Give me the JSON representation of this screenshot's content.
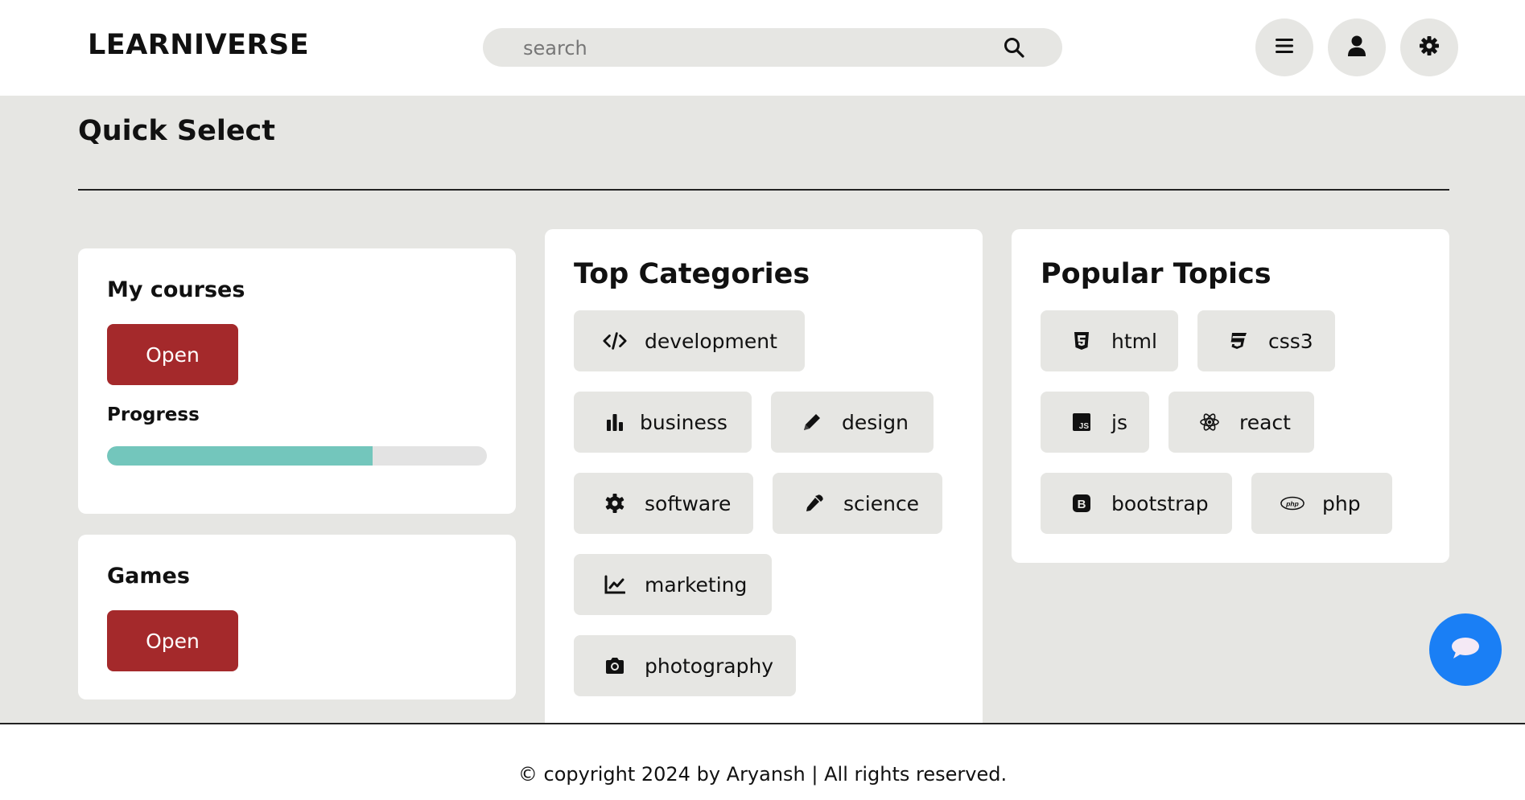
{
  "header": {
    "logo": "LEARNIVERSE",
    "search_placeholder": "search",
    "buttons": [
      "menu-icon",
      "user-icon",
      "gear-icon"
    ]
  },
  "main": {
    "title": "Quick Select",
    "my_courses": {
      "title": "My courses",
      "open_label": "Open",
      "progress_label": "Progress",
      "progress_fraction": 0.7
    },
    "games": {
      "title": "Games",
      "open_label": "Open"
    },
    "top_categories": {
      "title": "Top Categories",
      "items": [
        {
          "label": "development",
          "icon": "code-icon"
        },
        {
          "label": "business",
          "icon": "bar-chart-icon"
        },
        {
          "label": "design",
          "icon": "pencil-icon"
        },
        {
          "label": "software",
          "icon": "gear-icon"
        },
        {
          "label": "science",
          "icon": "pipette-icon"
        },
        {
          "label": "marketing",
          "icon": "line-chart-icon"
        },
        {
          "label": "photography",
          "icon": "camera-icon"
        }
      ]
    },
    "popular_topics": {
      "title": "Popular Topics",
      "items": [
        {
          "label": "html",
          "icon": "html5-icon"
        },
        {
          "label": "css3",
          "icon": "css3-icon"
        },
        {
          "label": "js",
          "icon": "js-icon"
        },
        {
          "label": "react",
          "icon": "react-icon"
        },
        {
          "label": "bootstrap",
          "icon": "bootstrap-icon"
        },
        {
          "label": "php",
          "icon": "php-icon"
        }
      ]
    }
  },
  "chat": {
    "icon": "chat-icon"
  },
  "footer": {
    "text": "© copyright 2024 by Aryansh | All rights reserved."
  },
  "colors": {
    "background": "#e6e6e3",
    "open_button": "#a4292b",
    "progress_fill": "#73c6bc",
    "chat_button": "#1a7ff5"
  }
}
